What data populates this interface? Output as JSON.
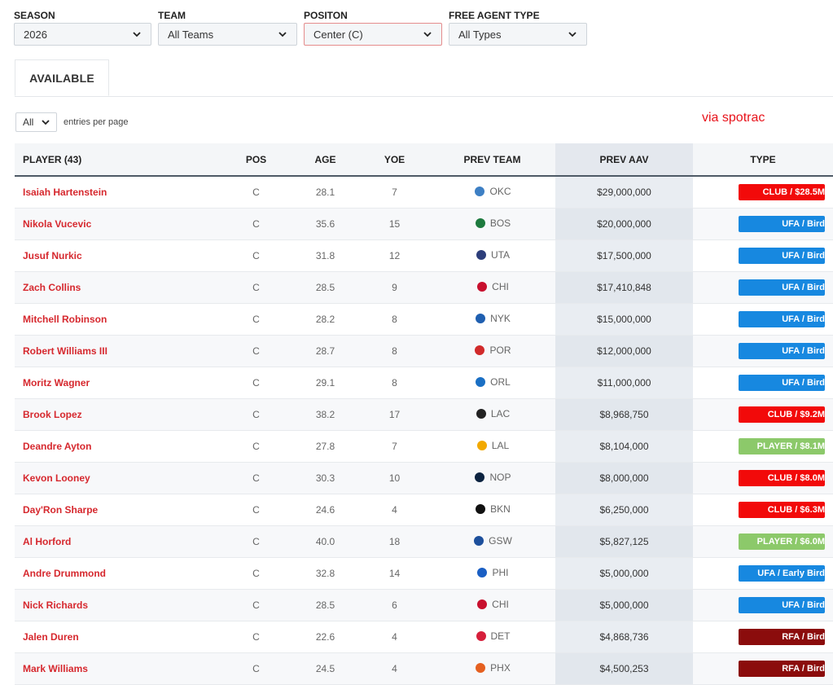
{
  "filters": {
    "season": {
      "label": "SEASON",
      "value": "2026"
    },
    "team": {
      "label": "TEAM",
      "value": "All Teams"
    },
    "position": {
      "label": "POSITON",
      "value": "Center (C)"
    },
    "fa_type": {
      "label": "FREE AGENT TYPE",
      "value": "All Types"
    }
  },
  "tabs": {
    "available": "AVAILABLE"
  },
  "entries": {
    "value": "All",
    "label": "entries per page"
  },
  "watermark": "via spotrac",
  "table": {
    "headers": {
      "player": "PLAYER (43)",
      "pos": "POS",
      "age": "AGE",
      "yoe": "YOE",
      "prev_team": "PREV TEAM",
      "prev_aav": "PREV AAV",
      "type": "TYPE"
    },
    "rows": [
      {
        "player": "Isaiah Hartenstein",
        "pos": "C",
        "age": "28.1",
        "yoe": "7",
        "team": "OKC",
        "aav": "$29,000,000",
        "type": "CLUB / $28.5M",
        "type_color": "#f20a0a",
        "logo_color": "#3d7fc4",
        "logo": "okc-logo-icon"
      },
      {
        "player": "Nikola Vucevic",
        "pos": "C",
        "age": "35.6",
        "yoe": "15",
        "team": "BOS",
        "aav": "$20,000,000",
        "type": "UFA / Bird",
        "type_color": "#1788e0",
        "logo_color": "#1d7a3e",
        "logo": "bos-logo-icon"
      },
      {
        "player": "Jusuf Nurkic",
        "pos": "C",
        "age": "31.8",
        "yoe": "12",
        "team": "UTA",
        "aav": "$17,500,000",
        "type": "UFA / Bird",
        "type_color": "#1788e0",
        "logo_color": "#2c3e7a",
        "logo": "uta-logo-icon"
      },
      {
        "player": "Zach Collins",
        "pos": "C",
        "age": "28.5",
        "yoe": "9",
        "team": "CHI",
        "aav": "$17,410,848",
        "type": "UFA / Bird",
        "type_color": "#1788e0",
        "logo_color": "#c8102e",
        "logo": "chi-logo-icon"
      },
      {
        "player": "Mitchell Robinson",
        "pos": "C",
        "age": "28.2",
        "yoe": "8",
        "team": "NYK",
        "aav": "$15,000,000",
        "type": "UFA / Bird",
        "type_color": "#1788e0",
        "logo_color": "#1f5fb0",
        "logo": "nyk-logo-icon"
      },
      {
        "player": "Robert Williams III",
        "pos": "C",
        "age": "28.7",
        "yoe": "8",
        "team": "POR",
        "aav": "$12,000,000",
        "type": "UFA / Bird",
        "type_color": "#1788e0",
        "logo_color": "#d12a2a",
        "logo": "por-logo-icon"
      },
      {
        "player": "Moritz Wagner",
        "pos": "C",
        "age": "29.1",
        "yoe": "8",
        "team": "ORL",
        "aav": "$11,000,000",
        "type": "UFA / Bird",
        "type_color": "#1788e0",
        "logo_color": "#1a6fc4",
        "logo": "orl-logo-icon"
      },
      {
        "player": "Brook Lopez",
        "pos": "C",
        "age": "38.2",
        "yoe": "17",
        "team": "LAC",
        "aav": "$8,968,750",
        "type": "CLUB / $9.2M",
        "type_color": "#f20a0a",
        "logo_color": "#222222",
        "logo": "lac-logo-icon"
      },
      {
        "player": "Deandre Ayton",
        "pos": "C",
        "age": "27.8",
        "yoe": "7",
        "team": "LAL",
        "aav": "$8,104,000",
        "type": "PLAYER / $8.1M",
        "type_color": "#8cc96a",
        "logo_color": "#f2a900",
        "logo": "lal-logo-icon"
      },
      {
        "player": "Kevon Looney",
        "pos": "C",
        "age": "30.3",
        "yoe": "10",
        "team": "NOP",
        "aav": "$8,000,000",
        "type": "CLUB / $8.0M",
        "type_color": "#f20a0a",
        "logo_color": "#0c2340",
        "logo": "nop-logo-icon"
      },
      {
        "player": "Day'Ron Sharpe",
        "pos": "C",
        "age": "24.6",
        "yoe": "4",
        "team": "BKN",
        "aav": "$6,250,000",
        "type": "CLUB / $6.3M",
        "type_color": "#f20a0a",
        "logo_color": "#111111",
        "logo": "bkn-logo-icon"
      },
      {
        "player": "Al Horford",
        "pos": "C",
        "age": "40.0",
        "yoe": "18",
        "team": "GSW",
        "aav": "$5,827,125",
        "type": "PLAYER / $6.0M",
        "type_color": "#8cc96a",
        "logo_color": "#1d4f9c",
        "logo": "gsw-logo-icon"
      },
      {
        "player": "Andre Drummond",
        "pos": "C",
        "age": "32.8",
        "yoe": "14",
        "team": "PHI",
        "aav": "$5,000,000",
        "type": "UFA / Early Bird",
        "type_color": "#1788e0",
        "logo_color": "#1a5fc4",
        "logo": "phi-logo-icon"
      },
      {
        "player": "Nick Richards",
        "pos": "C",
        "age": "28.5",
        "yoe": "6",
        "team": "CHI",
        "aav": "$5,000,000",
        "type": "UFA / Bird",
        "type_color": "#1788e0",
        "logo_color": "#c8102e",
        "logo": "chi-logo-icon"
      },
      {
        "player": "Jalen Duren",
        "pos": "C",
        "age": "22.6",
        "yoe": "4",
        "team": "DET",
        "aav": "$4,868,736",
        "type": "RFA / Bird",
        "type_color": "#8b0c0c",
        "logo_color": "#d61f3b",
        "logo": "det-logo-icon"
      },
      {
        "player": "Mark Williams",
        "pos": "C",
        "age": "24.5",
        "yoe": "4",
        "team": "PHX",
        "aav": "$4,500,253",
        "type": "RFA / Bird",
        "type_color": "#8b0c0c",
        "logo_color": "#e56020",
        "logo": "phx-logo-icon"
      }
    ]
  }
}
